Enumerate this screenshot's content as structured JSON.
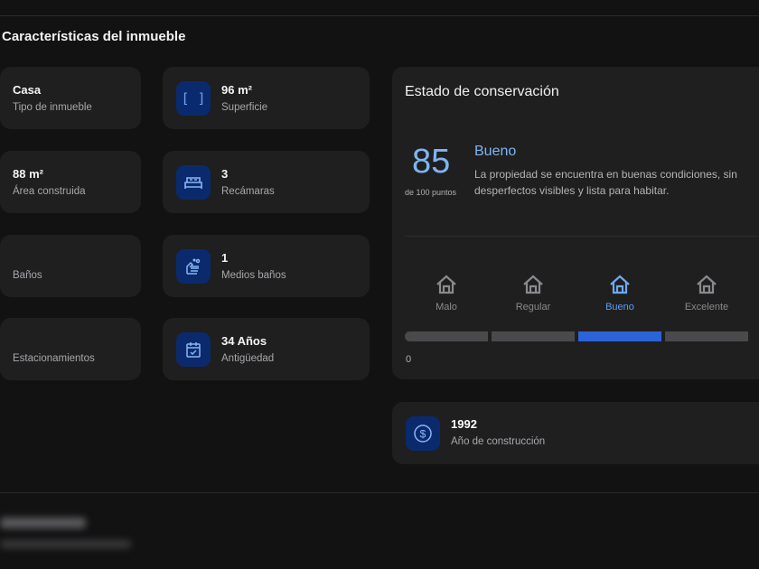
{
  "section": {
    "title": "Características del inmueble"
  },
  "features": [
    {
      "value": "Casa",
      "label": "Tipo de inmueble",
      "icon": "house-icon"
    },
    {
      "value": "96 m²",
      "label": "Superficie",
      "icon": "area-brackets-icon"
    },
    {
      "value": "88 m²",
      "label": "Área construida",
      "icon": "area-icon"
    },
    {
      "value": "3",
      "label": "Recámaras",
      "icon": "bed-icon"
    },
    {
      "value": "",
      "label": "Baños",
      "icon": "bath-icon"
    },
    {
      "value": "1",
      "label": "Medios baños",
      "icon": "hand-wash-icon"
    },
    {
      "value": "",
      "label": "Estacionamientos",
      "icon": "car-icon"
    },
    {
      "value": "34 Años",
      "label": "Antigüedad",
      "icon": "calendar-check-icon"
    }
  ],
  "conservation": {
    "title": "Estado de conservación",
    "score": "85",
    "score_sub": "de 100 puntos",
    "condition": "Bueno",
    "description_line1": "La propiedad se encuentra en buenas condiciones, sin",
    "description_line2": "desperfectos visibles y lista para habitar.",
    "levels": [
      "Malo",
      "Regular",
      "Bueno",
      "Excelente"
    ],
    "active_level": 2,
    "scale_min": "0",
    "accent": "#2d63d8"
  },
  "year_card": {
    "value": "1992",
    "label": "Año de construcción",
    "icon": "dollar-circle-icon"
  }
}
